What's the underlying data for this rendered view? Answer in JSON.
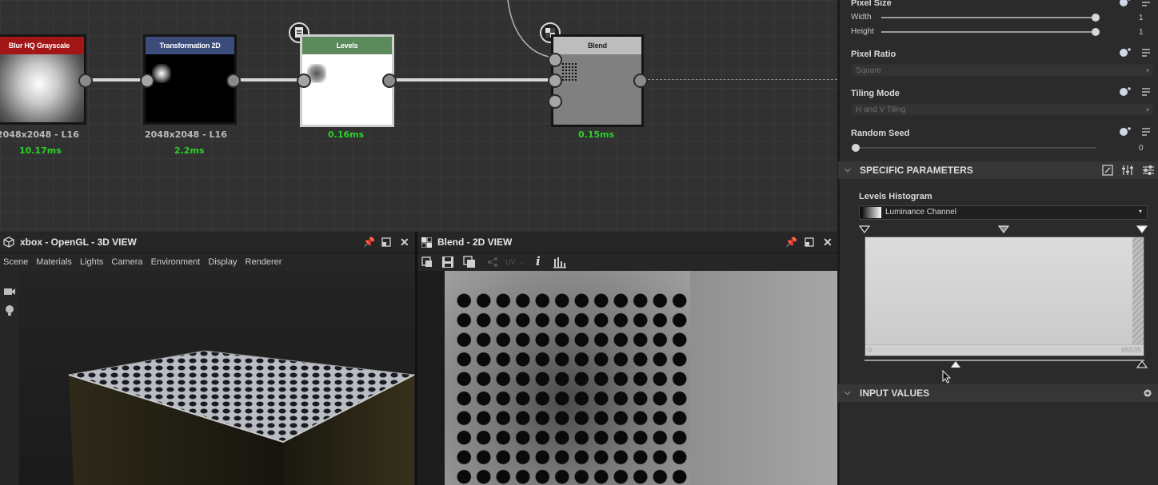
{
  "graph": {
    "nodes": {
      "blur": {
        "title": "Blur HQ Grayscale",
        "meta": "2048x2048 - L16",
        "time": "10.17ms"
      },
      "transform": {
        "title": "Transformation 2D",
        "meta": "2048x2048 - L16",
        "time": "2.2ms"
      },
      "levels": {
        "title": "Levels",
        "time": "0.16ms"
      },
      "blend": {
        "title": "Blend",
        "time": "0.15ms"
      }
    },
    "colors": {
      "blur_header": "#a31616",
      "transform_header": "#3b4c7a",
      "levels_header": "#5c8a5c",
      "blend_header": "#bdbdbd",
      "time_green": "#2bd12b"
    }
  },
  "view3d": {
    "title": "xbox - OpenGL - 3D VIEW",
    "menu": [
      "Scene",
      "Materials",
      "Lights",
      "Camera",
      "Environment",
      "Display",
      "Renderer"
    ],
    "icons": [
      "cube-icon",
      "pin-icon",
      "maximize-icon",
      "close-icon",
      "camera-icon",
      "light-icon"
    ]
  },
  "view2d": {
    "title": "Blend - 2D VIEW",
    "uv_label": "UV",
    "icons": [
      "checker-icon",
      "pin-icon",
      "maximize-icon",
      "close-icon",
      "fit-icon",
      "save-icon",
      "copy-icon",
      "share-icon",
      "info-icon",
      "histogram-icon"
    ]
  },
  "properties": {
    "pixel_size": {
      "label": "Pixel Size",
      "width_label": "Width",
      "width_value": "1",
      "height_label": "Height",
      "height_value": "1"
    },
    "pixel_ratio": {
      "label": "Pixel Ratio",
      "value": "Square"
    },
    "tiling_mode": {
      "label": "Tiling Mode",
      "value": "H and V Tiling"
    },
    "random_seed": {
      "label": "Random Seed",
      "value": "0"
    },
    "specific_parameters": {
      "label": "SPECIFIC PARAMETERS",
      "levels_histogram": {
        "label": "Levels Histogram",
        "channel": "Luminance Channel",
        "min_label": "0",
        "max_label": "65535"
      }
    },
    "input_values": {
      "label": "INPUT VALUES"
    }
  }
}
